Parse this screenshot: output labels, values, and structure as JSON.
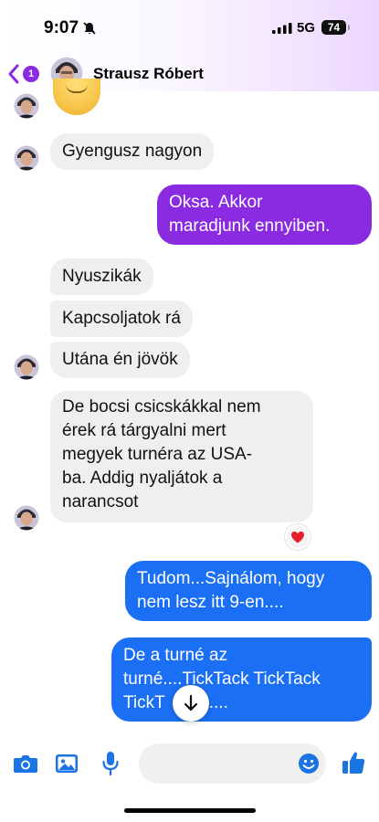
{
  "status_bar": {
    "time": "9:07",
    "network": "5G",
    "battery": "74"
  },
  "header": {
    "unread_count": "1",
    "contact_name": "Strausz Róbert"
  },
  "messages": [
    {
      "direction": "incoming",
      "text": "Gyengusz nagyon"
    },
    {
      "direction": "outgoing",
      "lines": [
        "Oksa. Akkor",
        "maradjunk ennyiben."
      ]
    },
    {
      "direction": "incoming",
      "text": "Nyuszikák"
    },
    {
      "direction": "incoming",
      "text": "Kapcsoljatok rá"
    },
    {
      "direction": "incoming",
      "text": "Utána én jövök"
    },
    {
      "direction": "incoming",
      "lines": [
        "De bocsi csicskákkal nem",
        "érek rá tárgyalni mert",
        "megyek turnéra az USA-",
        "ba. Addig nyaljátok a",
        "narancsot"
      ],
      "reaction": "heart"
    },
    {
      "direction": "outgoing",
      "lines": [
        "Tudom...Sajnálom, hogy",
        "nem lesz itt 9-en...."
      ]
    },
    {
      "direction": "outgoing",
      "lines": [
        "De a turné az",
        "turné....TickTack TickTack",
        "TickT",
        "...."
      ]
    }
  ],
  "composer": {
    "placeholder": "",
    "icons": [
      "camera-icon",
      "gallery-icon",
      "microphone-icon",
      "emoji-icon",
      "thumbs-up-icon"
    ]
  },
  "colors": {
    "purple_bubble": "#8a2be2",
    "blue_bubble": "#1b6ff5",
    "incoming_bubble": "#efefef",
    "accent": "#1b74e4"
  }
}
